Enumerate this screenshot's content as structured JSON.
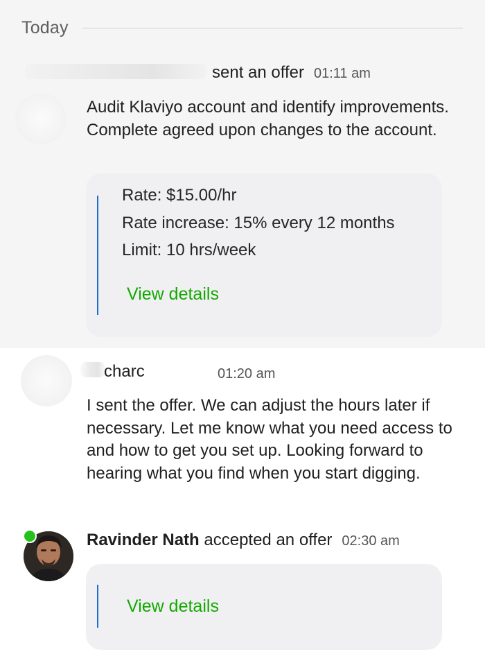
{
  "day": {
    "label": "Today"
  },
  "messages": [
    {
      "sender_tail": "sent an offer",
      "time": "01:11 am",
      "text": "Audit Klaviyo account and identify improvements. Complete agreed upon changes to the account.",
      "offer": {
        "rate": "Rate: $15.00/hr",
        "rate_increase": "Rate increase: 15% every 12 months",
        "limit": "Limit: 10 hrs/week",
        "link": "View details"
      }
    },
    {
      "sender_partial": "charc",
      "time": "01:20 am",
      "text": "I sent the offer. We can adjust the hours later if necessary. Let me know what you need access to and how to get you set up. Looking forward to hearing what you find when you start digging."
    },
    {
      "sender_name": "Ravinder Nath",
      "action": "accepted an offer",
      "time": "02:30 am",
      "online": true,
      "offer": {
        "link": "View details"
      }
    }
  ],
  "colors": {
    "accent_green": "#14a800",
    "bar_blue": "#1f6ccf",
    "online_green": "#26c11d",
    "highlight_bg": "#f5f5f6",
    "card_bg": "#f0f0f2"
  },
  "icons": [
    "avatar",
    "online-status-icon"
  ]
}
